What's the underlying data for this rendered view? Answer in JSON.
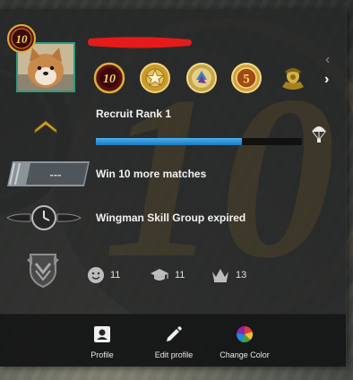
{
  "profile": {
    "rank_badge": "10",
    "username": ""
  },
  "medals": [
    {
      "name": "level-10-coin",
      "text": "10"
    },
    {
      "name": "star-coin",
      "text": ""
    },
    {
      "name": "map-coin",
      "text": ""
    },
    {
      "name": "service-5-coin",
      "text": "5"
    },
    {
      "name": "soldier-coin",
      "text": ""
    }
  ],
  "rank": {
    "title": "Recruit Rank 1",
    "progress": 0.71
  },
  "matches": {
    "text": "Win 10 more matches",
    "placeholder_rank": "---"
  },
  "wingman": {
    "text": "Wingman Skill Group expired"
  },
  "stats": [
    {
      "name": "friendly",
      "value": "11"
    },
    {
      "name": "teacher",
      "value": "11"
    },
    {
      "name": "leader",
      "value": "13"
    }
  ],
  "footer": {
    "profile": "Profile",
    "edit_profile": "Edit profile",
    "change_color": "Change Color"
  },
  "colors": {
    "accent_blue": "#3a9ee0",
    "avatar_border": "#2f9a7e",
    "gold": "#d9b23a"
  },
  "watermark": "10"
}
